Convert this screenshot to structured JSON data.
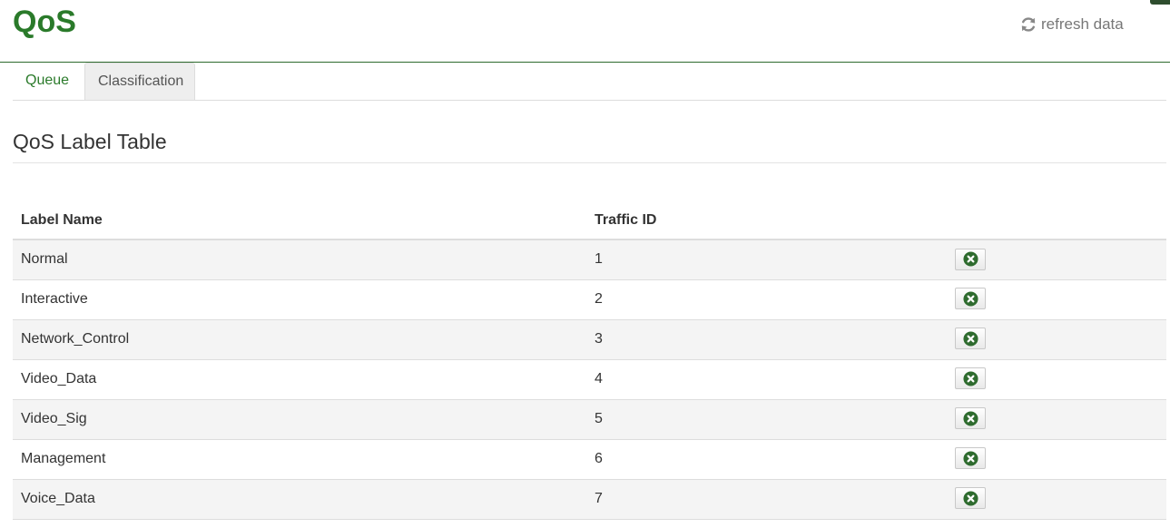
{
  "header": {
    "title": "QoS",
    "refresh_label": "refresh data",
    "refresh_icon": "refresh-icon"
  },
  "tabs": [
    {
      "label": "Queue",
      "active": false
    },
    {
      "label": "Classification",
      "active": true
    }
  ],
  "section": {
    "title": "QoS Label Table"
  },
  "table": {
    "columns": [
      "Label Name",
      "Traffic ID",
      ""
    ],
    "rows": [
      {
        "name": "Normal",
        "id": "1"
      },
      {
        "name": "Interactive",
        "id": "2"
      },
      {
        "name": "Network_Control",
        "id": "3"
      },
      {
        "name": "Video_Data",
        "id": "4"
      },
      {
        "name": "Video_Sig",
        "id": "5"
      },
      {
        "name": "Management",
        "id": "6"
      },
      {
        "name": "Voice_Data",
        "id": "7"
      }
    ],
    "row_action_icon": "delete-icon"
  },
  "colors": {
    "brand_green": "#2a7a2a",
    "delete_icon": "#2e6b2e"
  }
}
